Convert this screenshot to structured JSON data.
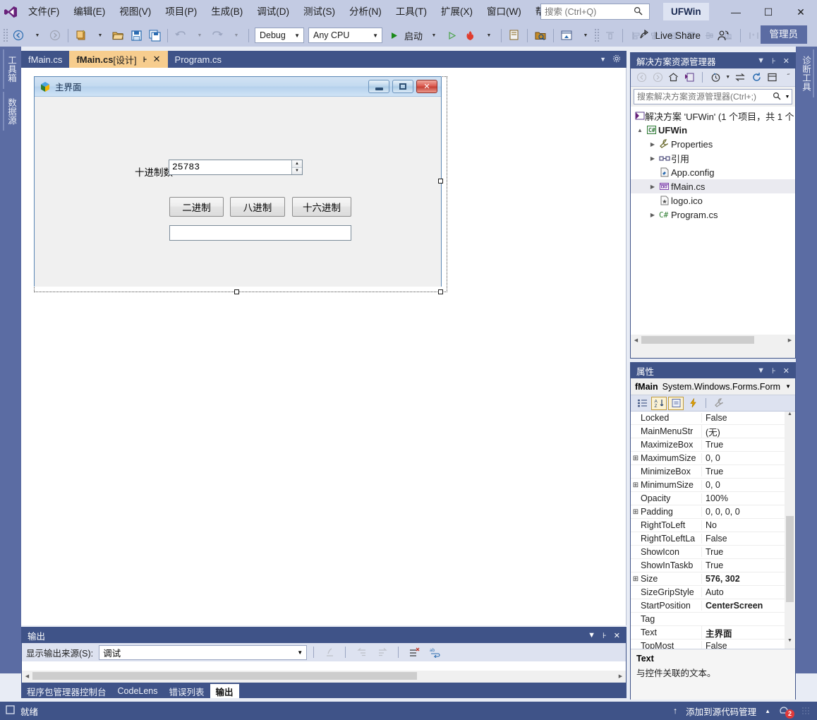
{
  "menu": {
    "logo_icon": "visual-studio-logo",
    "items": [
      {
        "label": "文件(F)"
      },
      {
        "label": "编辑(E)"
      },
      {
        "label": "视图(V)"
      },
      {
        "label": "项目(P)"
      },
      {
        "label": "生成(B)"
      },
      {
        "label": "调试(D)"
      },
      {
        "label": "测试(S)"
      },
      {
        "label": "分析(N)"
      },
      {
        "label": "工具(T)"
      },
      {
        "label": "扩展(X)"
      },
      {
        "label": "窗口(W)"
      },
      {
        "label": "帮助(H)"
      }
    ],
    "search_placeholder": "搜索 (Ctrl+Q)",
    "search_value": "",
    "project_badge": "UFWin",
    "window_controls": {
      "minimize": "—",
      "maximize": "☐",
      "close": "✕"
    }
  },
  "toolbar": {
    "back_label": "◀",
    "forward_label": "▶",
    "config_value": "Debug",
    "platform_value": "Any CPU",
    "start_label": "启动",
    "live_share_label": "Live Share",
    "admin_label": "管理员"
  },
  "left_dock": {
    "tabs": [
      "工具箱",
      "数据源"
    ]
  },
  "right_dock": {
    "tabs": [
      "诊断工具"
    ]
  },
  "document_tabs": [
    {
      "label": "fMain.cs",
      "active": false
    },
    {
      "label": "fMain.cs",
      "suffix": " [设计]",
      "active": true,
      "pin": "⊦",
      "close": "✕"
    },
    {
      "label": "Program.cs",
      "active": false
    }
  ],
  "designer": {
    "form": {
      "title": "主界面",
      "icon": "form-app-icon",
      "minimize": "minimize-glyph",
      "maximize": "maximize-glyph",
      "close": "✕"
    },
    "controls": {
      "decimal_label": "十进制数",
      "decimal_value": "25783",
      "spin_up": "▲",
      "spin_down": "▼",
      "buttons": [
        "二进制",
        "八进制",
        "十六进制"
      ],
      "result_value": ""
    }
  },
  "solution_explorer": {
    "title": "解决方案资源管理器",
    "search_placeholder": "搜索解决方案资源管理器(Ctrl+;)",
    "search_value": "",
    "tree": [
      {
        "indent": 0,
        "arrow": "",
        "icon": "solution-icon",
        "label": "解决方案 'UFWin' (1 个项目，共 1 个",
        "bold": false,
        "selected": false
      },
      {
        "indent": 1,
        "arrow": "▲",
        "icon": "csharp-project-icon",
        "label": "UFWin",
        "bold": true,
        "selected": false
      },
      {
        "indent": 2,
        "arrow": "▶",
        "icon": "properties-wrench-icon",
        "label": "Properties",
        "bold": false,
        "selected": false
      },
      {
        "indent": 2,
        "arrow": "▶",
        "icon": "references-icon",
        "label": "引用",
        "bold": false,
        "selected": false
      },
      {
        "indent": 3,
        "arrow": "",
        "icon": "config-file-icon",
        "label": "App.config",
        "bold": false,
        "selected": false
      },
      {
        "indent": 2,
        "arrow": "▶",
        "icon": "form-file-icon",
        "label": "fMain.cs",
        "bold": false,
        "selected": true
      },
      {
        "indent": 3,
        "arrow": "",
        "icon": "icon-file-icon",
        "label": "logo.ico",
        "bold": false,
        "selected": false
      },
      {
        "indent": 2,
        "arrow": "▶",
        "icon": "csharp-file-icon",
        "label": "Program.cs",
        "bold": false,
        "selected": false
      }
    ]
  },
  "properties": {
    "title": "属性",
    "object_name": "fMain",
    "object_type": "System.Windows.Forms.Form",
    "rows": [
      {
        "expand": false,
        "name": "Locked",
        "value": "False",
        "bold": false
      },
      {
        "expand": false,
        "name": "MainMenuStr",
        "value": "(无)",
        "bold": false
      },
      {
        "expand": false,
        "name": "MaximizeBox",
        "value": "True",
        "bold": false
      },
      {
        "expand": true,
        "name": "MaximumSize",
        "value": "0, 0",
        "bold": false
      },
      {
        "expand": false,
        "name": "MinimizeBox",
        "value": "True",
        "bold": false
      },
      {
        "expand": true,
        "name": "MinimumSize",
        "value": "0, 0",
        "bold": false
      },
      {
        "expand": false,
        "name": "Opacity",
        "value": "100%",
        "bold": false
      },
      {
        "expand": true,
        "name": "Padding",
        "value": "0, 0, 0, 0",
        "bold": false
      },
      {
        "expand": false,
        "name": "RightToLeft",
        "value": "No",
        "bold": false
      },
      {
        "expand": false,
        "name": "RightToLeftLa",
        "value": "False",
        "bold": false
      },
      {
        "expand": false,
        "name": "ShowIcon",
        "value": "True",
        "bold": false
      },
      {
        "expand": false,
        "name": "ShowInTaskb",
        "value": "True",
        "bold": false
      },
      {
        "expand": true,
        "name": "Size",
        "value": "576, 302",
        "bold": true
      },
      {
        "expand": false,
        "name": "SizeGripStyle",
        "value": "Auto",
        "bold": false
      },
      {
        "expand": false,
        "name": "StartPosition",
        "value": "CenterScreen",
        "bold": true
      },
      {
        "expand": false,
        "name": "Tag",
        "value": "",
        "bold": false
      },
      {
        "expand": false,
        "name": "Text",
        "value": "主界面",
        "bold": true
      },
      {
        "expand": false,
        "name": "TopMost",
        "value": "False",
        "bold": false
      }
    ],
    "description_title": "Text",
    "description_text": "与控件关联的文本。"
  },
  "output": {
    "title": "输出",
    "source_label": "显示输出来源(S):",
    "source_value": "调试",
    "content": ""
  },
  "bottom_tabs": [
    {
      "label": "程序包管理器控制台",
      "active": false
    },
    {
      "label": "CodeLens",
      "active": false
    },
    {
      "label": "错误列表",
      "active": false
    },
    {
      "label": "输出",
      "active": true
    }
  ],
  "status_bar": {
    "ready_text": "就绪",
    "source_control_text": "添加到源代码管理",
    "notification_count": "2"
  }
}
